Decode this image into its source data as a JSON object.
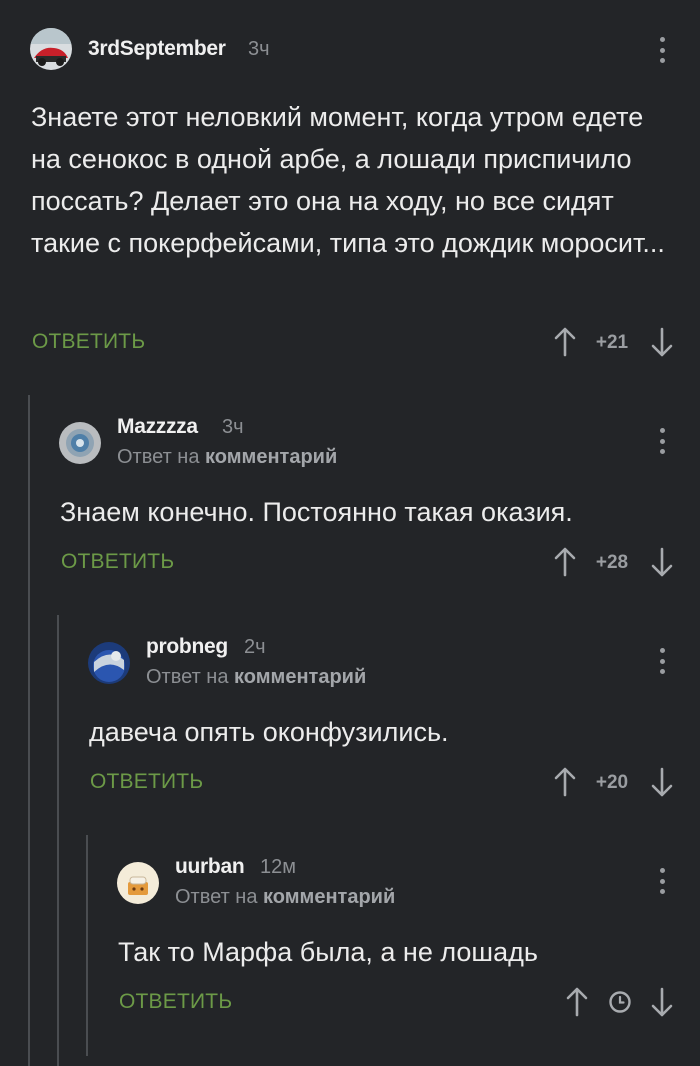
{
  "comments": [
    {
      "username": "3rdSeptember",
      "time": "3ч",
      "text": "Знаете этот неловкий момент, когда утром едете на сенокос в одной арбе, а лошади приспичило поссать? Делает это она на ходу, но все сидят такие с покерфейсами, типа это дождик моросит...",
      "reply_label": "ОТВЕТИТЬ",
      "score": "+21"
    },
    {
      "username": "Mazzzza",
      "time": "3ч",
      "reply_prefix": "Ответ на",
      "reply_link": "комментарий",
      "text": "Знаем конечно. Постоянно такая оказия.",
      "reply_label": "ОТВЕТИТЬ",
      "score": "+28"
    },
    {
      "username": "probneg",
      "time": "2ч",
      "reply_prefix": "Ответ на",
      "reply_link": "комментарий",
      "text": "давеча опять оконфузились.",
      "reply_label": "ОТВЕТИТЬ",
      "score": "+20"
    },
    {
      "username": "uurban",
      "time": "12м",
      "reply_prefix": "Ответ на",
      "reply_link": "комментарий",
      "text": "Так то Марфа была, а не лошадь",
      "reply_label": "ОТВЕТИТЬ",
      "score_icon": "clock-icon"
    }
  ],
  "colors": {
    "background": "#232528",
    "accent_green": "#6c9a47",
    "muted": "#8c8f93",
    "thread_line": "#4a4d51"
  }
}
